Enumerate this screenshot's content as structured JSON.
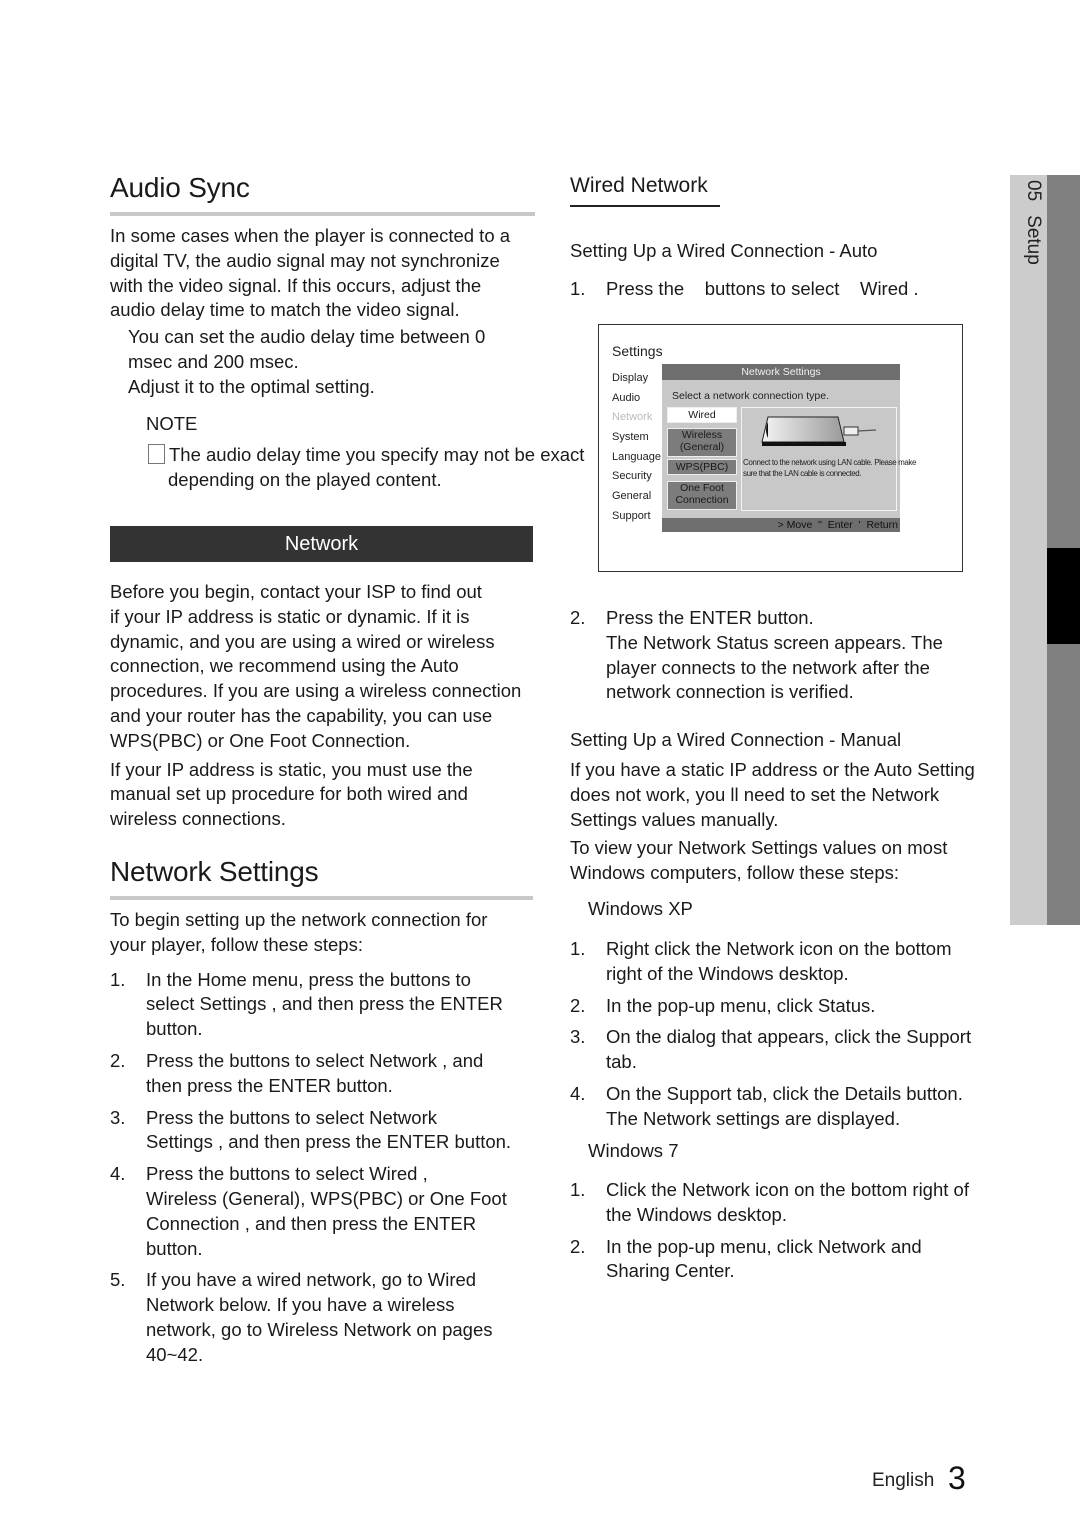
{
  "left": {
    "audio_sync": {
      "title": "Audio Sync",
      "intro": [
        "In some cases when the player is connected to a",
        "digital TV, the audio signal may not synchronize",
        "with the video signal. If this occurs, adjust the",
        "audio delay time to match the video signal."
      ],
      "bullets": [
        "You can set the audio delay time between 0",
        "msec and 200 msec.",
        "Adjust it to the optimal setting."
      ],
      "note_label": "NOTE",
      "note_lines": [
        "The audio delay time you specify may not be exact",
        "depending on the played content."
      ]
    },
    "network_bar": "Network",
    "network_para1": [
      "Before you begin, contact your ISP to find out",
      "if your IP address is static or dynamic. If it is",
      "dynamic, and you are using a wired or wireless",
      "connection, we recommend using the Auto",
      "procedures. If you are using a wireless connection",
      "and your router has the capability, you can use",
      "WPS(PBC) or One Foot Connection."
    ],
    "network_para2": [
      "If your IP address is static, you must use the",
      "manual set up procedure for both wired and",
      "wireless connections."
    ],
    "network_settings": {
      "title": "Network Settings",
      "intro": [
        "To begin setting up the network connection for",
        "your player, follow these steps:"
      ],
      "steps": [
        {
          "num": "1.",
          "lines": [
            "In the Home menu, press the    buttons to",
            "select Settings , and then press the ENTER",
            "button."
          ]
        },
        {
          "num": "2.",
          "lines": [
            "Press the    buttons to select    Network , and",
            "then press the ENTER button."
          ]
        },
        {
          "num": "3.",
          "lines": [
            "Press the    buttons to select    Network",
            "Settings , and then press the ENTER button."
          ]
        },
        {
          "num": "4.",
          "lines": [
            "Press the    buttons to select    Wired ,",
            "Wireless (General), WPS(PBC) or One Foot",
            "Connection , and then press the ENTER",
            "button."
          ]
        },
        {
          "num": "5.",
          "lines": [
            "If you have a wired network, go to Wired",
            "Network below. If you have a wireless",
            "network, go to Wireless Network on pages",
            "40~42."
          ]
        }
      ]
    }
  },
  "right": {
    "wired_title": "Wired Network",
    "auto_heading": "Setting Up a Wired Connection - Auto",
    "auto_step1": {
      "num": "1.",
      "text": "Press the    buttons to select    Wired ."
    },
    "screen": {
      "title": "Settings",
      "menu": [
        "Display",
        "Audio",
        "Network",
        "System",
        "Language",
        "Security",
        "General",
        "Support"
      ],
      "dialog_title": "Network Settings",
      "prompt": "Select a network connection type.",
      "options": [
        "Wired",
        "Wireless (General)",
        "WPS(PBC)",
        "One Foot Connection"
      ],
      "selected_option": "Wired",
      "info": "Connect to the network using LAN cable. Please make sure that the LAN cable is connected.",
      "footer": "> Move  \"  Enter  '  Return"
    },
    "auto_step2": {
      "num": "2.",
      "lines": [
        "Press the ENTER button.",
        "The Network Status screen appears. The",
        "player connects to the network after the",
        "network connection is verified."
      ]
    },
    "manual_heading": "Setting Up a Wired Connection - Manual",
    "manual_para1": [
      "If you have a static IP address or the Auto Setting",
      "does not work, you ll need to set the Network",
      "Settings values manually."
    ],
    "manual_para2": [
      "To view your Network Settings values on most",
      "Windows computers, follow these steps:"
    ],
    "xp_label": "Windows XP",
    "xp_steps": [
      {
        "num": "1.",
        "lines": [
          "Right click the Network icon on the bottom",
          "right of the Windows desktop."
        ]
      },
      {
        "num": "2.",
        "lines": [
          "In the pop-up menu, click Status."
        ]
      },
      {
        "num": "3.",
        "lines": [
          "On the dialog that appears, click the Support",
          "tab."
        ]
      },
      {
        "num": "4.",
        "lines": [
          "On the Support tab, click the Details button.",
          "The Network settings are displayed."
        ]
      }
    ],
    "win7_label": "Windows 7",
    "win7_steps": [
      {
        "num": "1.",
        "lines": [
          "Click the Network icon on the bottom right of",
          "the Windows desktop."
        ]
      },
      {
        "num": "2.",
        "lines": [
          "In the pop-up menu, click Network and",
          "Sharing Center."
        ]
      }
    ]
  },
  "side_tab": {
    "chapter": "05",
    "label": "Setup"
  },
  "footer": {
    "language": "English",
    "page": "3"
  }
}
